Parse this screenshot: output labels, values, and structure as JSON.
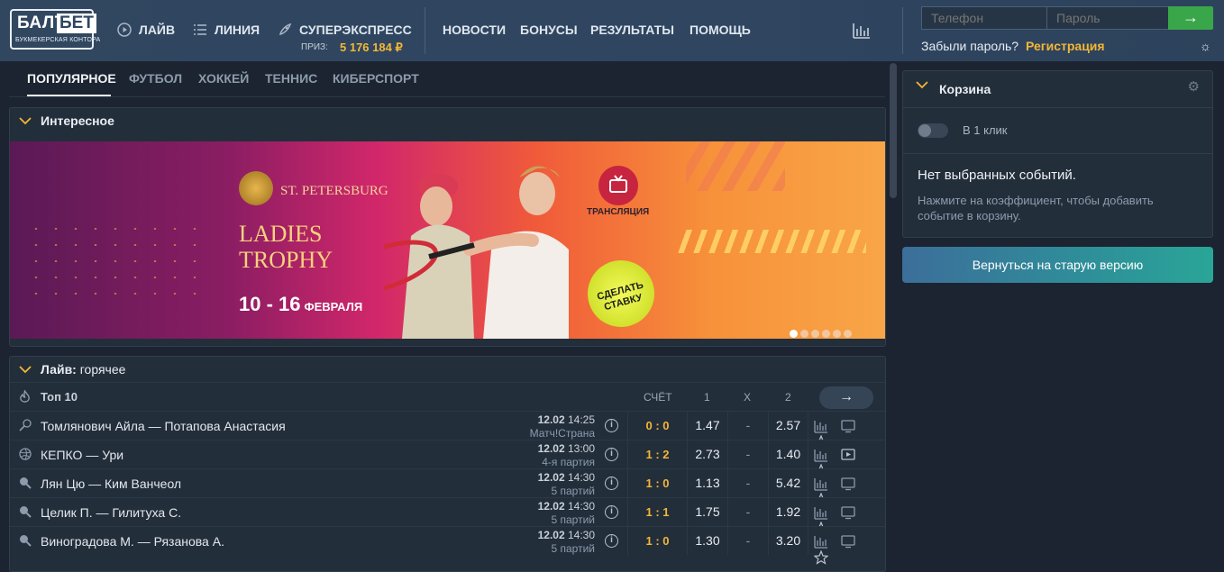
{
  "header": {
    "logo": {
      "part1": "БАЛТ",
      "part2": "БЕТ",
      "subtitle": "БУКМЕКЕРСКАЯ КОНТОРА"
    },
    "nav": [
      {
        "label": "ЛАЙВ",
        "icon": "play-icon"
      },
      {
        "label": "ЛИНИЯ",
        "icon": "list-icon"
      },
      {
        "label": "СУПЕРЭКСПРЕСС",
        "icon": "rocket-icon"
      }
    ],
    "prize_label": "ПРИЗ:",
    "prize_value": "5 176 184 ₽",
    "links": [
      "НОВОСТИ",
      "БОНУСЫ",
      "РЕЗУЛЬТАТЫ",
      "ПОМОЩЬ"
    ],
    "phone_placeholder": "Телефон",
    "password_placeholder": "Пароль",
    "forgot": "Забыли пароль?",
    "register": "Регистрация"
  },
  "tabs": [
    "ПОПУЛЯРНОЕ",
    "ФУТБОЛ",
    "ХОККЕЙ",
    "ТЕННИС",
    "КИБЕРСПОРТ"
  ],
  "interesting": {
    "title": "Интересное",
    "banner": {
      "city": "ST. PETERSBURG",
      "trophy_line1": "LADIES",
      "trophy_line2": "TROPHY",
      "dates": "10 - 16",
      "month": "ФЕВРАЛЯ",
      "broadcast": "ТРАНСЛЯЦИЯ",
      "bet_line1": "СДЕЛАТЬ",
      "bet_line2": "СТАВКУ",
      "slides": 6,
      "active_slide": 1
    }
  },
  "live": {
    "title_bold": "Лайв:",
    "title_rest": " горячее",
    "subheader": "Топ 10",
    "col_score": "СЧЁТ",
    "col_1": "1",
    "col_x": "X",
    "col_2": "2",
    "rows": [
      {
        "sport_icon": "tennis-racket-icon",
        "teams": "Томлянович Айла — Потапова Анастасия",
        "date": "12.02",
        "time": "14:25",
        "stage": "Матч!Страна",
        "score": "0 : 0",
        "o1": "1.47",
        "ox": "-",
        "o2": "2.57",
        "tv": "tv-icon"
      },
      {
        "sport_icon": "volleyball-icon",
        "teams": "КЕПКО — Ури",
        "date": "12.02",
        "time": "13:00",
        "stage": "4-я партия",
        "score": "1 : 2",
        "o1": "2.73",
        "ox": "-",
        "o2": "1.40",
        "tv": "play-video-icon"
      },
      {
        "sport_icon": "table-tennis-icon",
        "teams": "Лян Цю — Ким Ванчеол",
        "date": "12.02",
        "time": "14:30",
        "stage": "5 партий",
        "score": "1 : 0",
        "o1": "1.13",
        "ox": "-",
        "o2": "5.42",
        "tv": "tv-icon"
      },
      {
        "sport_icon": "table-tennis-icon",
        "teams": "Целик П. — Гилитуха С.",
        "date": "12.02",
        "time": "14:30",
        "stage": "5 партий",
        "score": "1 : 1",
        "o1": "1.75",
        "ox": "-",
        "o2": "1.92",
        "tv": "tv-icon"
      },
      {
        "sport_icon": "table-tennis-icon",
        "teams": "Виноградова М. — Рязанова А.",
        "date": "12.02",
        "time": "14:30",
        "stage": "5 партий",
        "score": "1 : 0",
        "o1": "1.30",
        "ox": "-",
        "o2": "3.20",
        "tv": "tv-icon"
      }
    ]
  },
  "basket": {
    "title": "Корзина",
    "one_click": "В 1 клик",
    "empty_title": "Нет выбранных событий.",
    "empty_desc": "Нажмите на коэффициент, чтобы добавить событие в корзину."
  },
  "old_version": "Вернуться на старую версию",
  "colors": {
    "accent": "#f4b735",
    "green": "#3aa64a",
    "bg": "#1b2430",
    "panel": "#232e3b"
  }
}
